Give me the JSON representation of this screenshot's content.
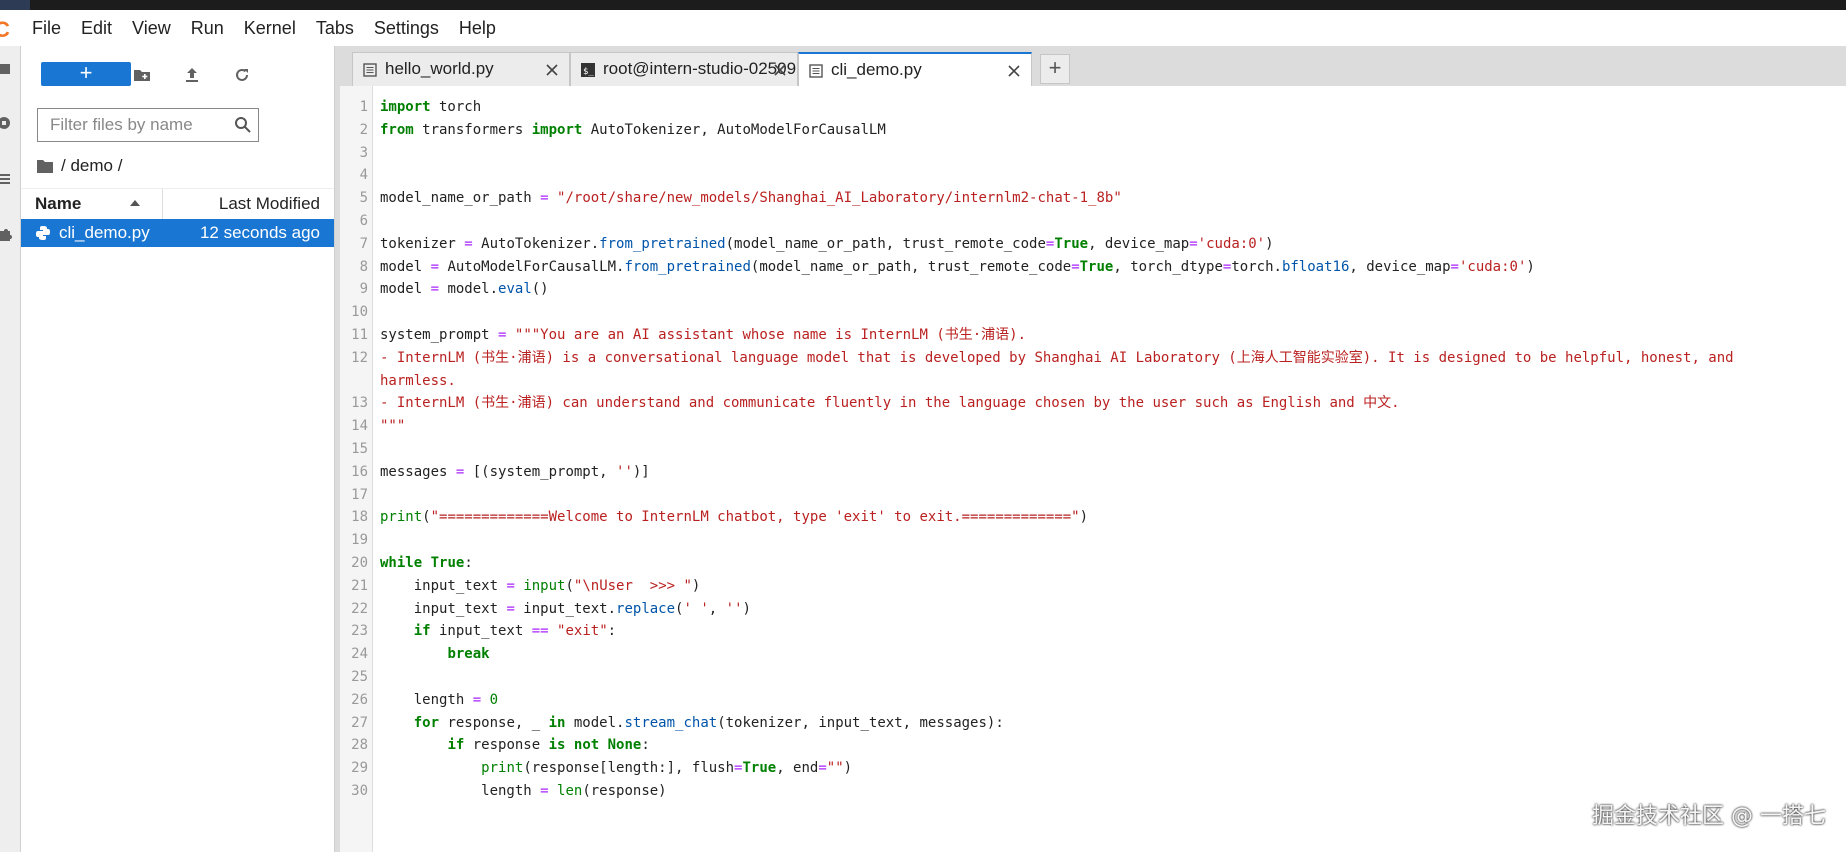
{
  "menu": [
    "File",
    "Edit",
    "View",
    "Run",
    "Kernel",
    "Tabs",
    "Settings",
    "Help"
  ],
  "filebrowser": {
    "new_label": "+",
    "search_placeholder": "Filter files by name",
    "breadcrumb": "/ demo /",
    "col_name": "Name",
    "col_modified": "Last Modified",
    "files": [
      {
        "name": "cli_demo.py",
        "modified": "12 seconds ago"
      }
    ]
  },
  "tabs": [
    {
      "label": "hello_world.py",
      "icon": "text-file-icon",
      "active": false
    },
    {
      "label": "root@intern-studio-02509",
      "icon": "terminal-icon",
      "active": false
    },
    {
      "label": "cli_demo.py",
      "icon": "text-file-icon",
      "active": true
    }
  ],
  "add_tab_label": "+",
  "code_lines": [
    "import torch",
    "from transformers import AutoTokenizer, AutoModelForCausalLM",
    "",
    "",
    "model_name_or_path = \"/root/share/new_models/Shanghai_AI_Laboratory/internlm2-chat-1_8b\"",
    "",
    "tokenizer = AutoTokenizer.from_pretrained(model_name_or_path, trust_remote_code=True, device_map='cuda:0')",
    "model = AutoModelForCausalLM.from_pretrained(model_name_or_path, trust_remote_code=True, torch_dtype=torch.bfloat16, device_map='cuda:0')",
    "model = model.eval()",
    "",
    "system_prompt = \"\"\"You are an AI assistant whose name is InternLM (书生·浦语).",
    "- InternLM (书生·浦语) is a conversational language model that is developed by Shanghai AI Laboratory (上海人工智能实验室). It is designed to be helpful, honest, and",
    "harmless.",
    "- InternLM (书生·浦语) can understand and communicate fluently in the language chosen by the user such as English and 中文.",
    "\"\"\"",
    "",
    "messages = [(system_prompt, '')]",
    "",
    "print(\"=============Welcome to InternLM chatbot, type 'exit' to exit.=============\")",
    "",
    "while True:",
    "    input_text = input(\"\\nUser  >>> \")",
    "    input_text = input_text.replace(' ', '')",
    "    if input_text == \"exit\":",
    "        break",
    "",
    "    length = 0",
    "    for response, _ in model.stream_chat(tokenizer, input_text, messages):",
    "        if response is not None:",
    "            print(response[length:], flush=True, end=\"\")",
    "            length = len(response)"
  ],
  "line_numbers": [
    "1",
    "2",
    "3",
    "4",
    "5",
    "6",
    "7",
    "8",
    "9",
    "10",
    "11",
    "12",
    "",
    "13",
    "14",
    "15",
    "16",
    "17",
    "18",
    "19",
    "20",
    "21",
    "22",
    "23",
    "24",
    "25",
    "26",
    "27",
    "28",
    "29",
    "30"
  ],
  "watermark": "掘金技术社区 @ 一搭七",
  "colors": {
    "accent": "#1976d2",
    "keyword": "#008000",
    "string": "#ba2121"
  }
}
